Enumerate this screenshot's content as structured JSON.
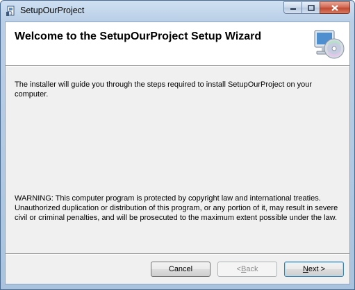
{
  "window": {
    "title": "SetupOurProject"
  },
  "banner": {
    "heading": "Welcome to the SetupOurProject Setup Wizard"
  },
  "body": {
    "intro": "The installer will guide you through the steps required to install SetupOurProject on your computer.",
    "warning": "WARNING: This computer program is protected by copyright law and international treaties. Unauthorized duplication or distribution of this program, or any portion of it, may result in severe civil or criminal penalties, and will be prosecuted to the maximum extent possible under the law."
  },
  "buttons": {
    "cancel": "Cancel",
    "back_prefix": "< ",
    "back_accel": "B",
    "back_rest": "ack",
    "next_accel": "N",
    "next_rest": "ext >"
  },
  "colors": {
    "title_bar": "#b9cfe6",
    "client_bg": "#f0f0f0",
    "close_button": "#c14a32"
  }
}
